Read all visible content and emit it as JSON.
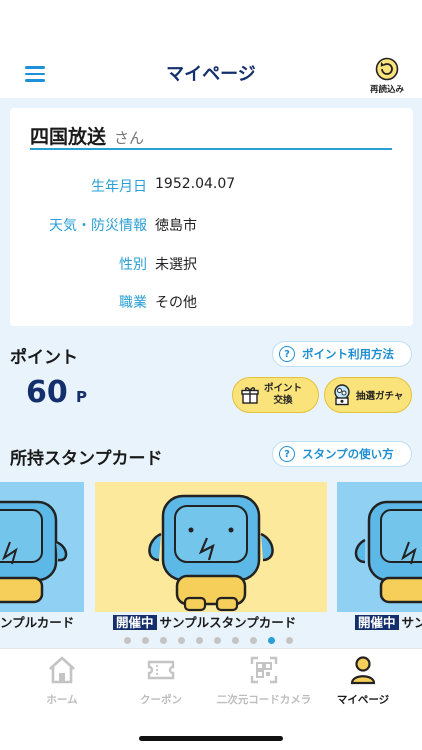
{
  "header": {
    "title": "マイページ",
    "reload_label": "再読込み"
  },
  "profile": {
    "name": "四国放送",
    "honorific": "さん",
    "fields": [
      {
        "label": "生年月日",
        "value": "1952.04.07"
      },
      {
        "label": "天気・防災情報",
        "value": "徳島市"
      },
      {
        "label": "性別",
        "value": "未選択"
      },
      {
        "label": "職業",
        "value": "その他"
      }
    ]
  },
  "points": {
    "title": "ポイント",
    "help_label": "ポイント利用方法",
    "value": "60",
    "unit": "P",
    "exchange_label_line1": "ポイント",
    "exchange_label_line2": "交換",
    "gacha_label": "抽選ガチャ"
  },
  "stamps": {
    "title": "所持スタンプカード",
    "help_label": "スタンプの使い方",
    "left_caption": "ンプルカード",
    "center_badge": "開催中",
    "center_caption": "サンプルスタンプカード",
    "right_badge": "開催中",
    "right_caption": "サン",
    "page_count": 10,
    "active_page": 9
  },
  "tabbar": {
    "items": [
      {
        "label": "ホーム",
        "icon": "home-icon"
      },
      {
        "label": "クーポン",
        "icon": "ticket-icon"
      },
      {
        "label": "二次元コードカメラ",
        "icon": "qr-camera-icon"
      },
      {
        "label": "マイページ",
        "icon": "person-icon"
      }
    ],
    "active_index": 3
  },
  "colors": {
    "accent": "#2a9fd6",
    "navy": "#142f6b",
    "yellow": "#fbe37c",
    "card_blue": "#8fd0f3",
    "card_yellow": "#fce99c"
  }
}
